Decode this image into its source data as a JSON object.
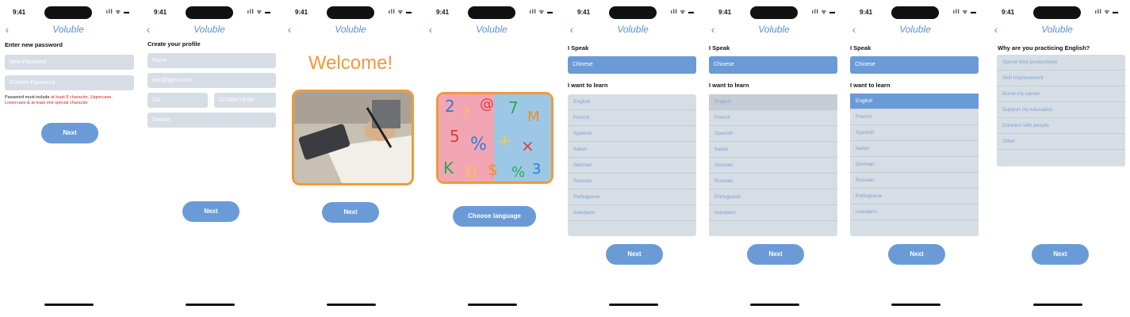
{
  "status": {
    "time": "9:41",
    "indicators": "ıll ᯤ ▬"
  },
  "app": {
    "logo": "Voluble",
    "back": "‹"
  },
  "s1": {
    "title": "Enter new password",
    "new_password_placeholder": "New Password",
    "confirm_password_placeholder": "Confirm Password",
    "hint_prefix": "Password must include ",
    "hint_red_1": "at least 8 character, Uppercase,",
    "hint_red_2": "Lowercase & at least one special character",
    "next": "Next"
  },
  "s2": {
    "title": "Create your profile",
    "name_placeholder": "Name",
    "email_placeholder": "xyz@figma.com",
    "country_placeholder": "CA",
    "dob_placeholder": "DD/MM/YEAR",
    "gender_placeholder": "Gender",
    "next": "Next"
  },
  "s3": {
    "welcome": "Welcome!",
    "next": "Next"
  },
  "s4": {
    "choose": "Choose language"
  },
  "lang": {
    "speak_label": "I Speak",
    "speak_value": "Chinese",
    "learn_label": "I want to learn",
    "options": [
      "English",
      "French",
      "Spanish",
      "Italian",
      "German",
      "Russian",
      "Portuguese",
      "mandarin"
    ],
    "next": "Next"
  },
  "s8": {
    "title": "Why are you practicing English?",
    "reasons": [
      "Spend time productively",
      "Skill Improvement",
      "Boost my career",
      "Support my education",
      "Connect with people",
      "Other"
    ],
    "next": "Next"
  },
  "colors": {
    "accent": "#6a9bd6",
    "field": "#d7dde5",
    "orange": "#f09a3a",
    "error": "#e02020"
  }
}
